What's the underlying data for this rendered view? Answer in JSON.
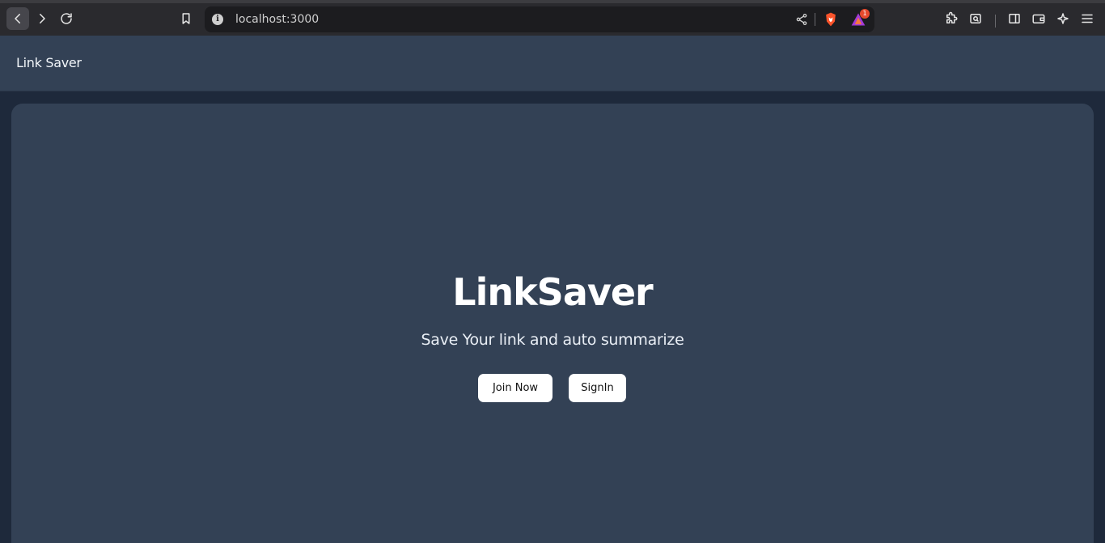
{
  "browser": {
    "url": "localhost:3000",
    "rewards_badge": "1",
    "icons": [
      "back-icon",
      "forward-icon",
      "reload-icon",
      "bookmark-icon",
      "info-icon",
      "share-icon",
      "brave-shield-icon",
      "rewards-icon",
      "extensions-icon",
      "screenshot-icon",
      "sidebar-icon",
      "wallet-icon",
      "ai-icon",
      "menu-icon"
    ]
  },
  "header": {
    "brand": "Link Saver"
  },
  "hero": {
    "title": "LinkSaver",
    "subtitle": "Save Your link and auto summarize",
    "join_label": "Join Now",
    "signin_label": "SignIn"
  },
  "colors": {
    "page_bg": "#1e293b",
    "surface": "#334155",
    "chrome_bg": "#2a2a2e",
    "button_bg": "#ffffff"
  }
}
